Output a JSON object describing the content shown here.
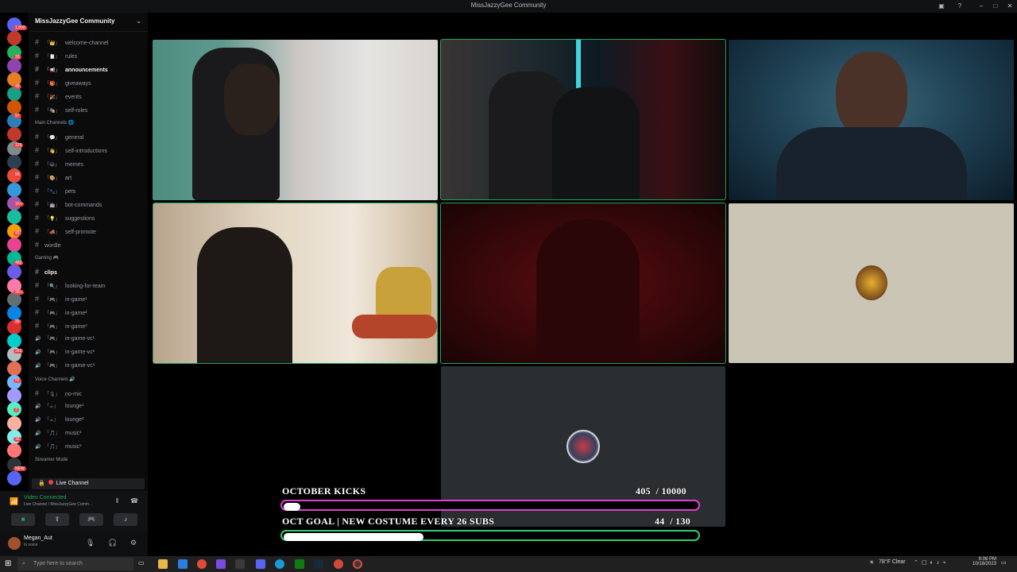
{
  "window": {
    "title": "MissJazzyGee Community"
  },
  "server": {
    "name": "MissJazzyGee Community"
  },
  "channels": [
    {
      "emoji": "「👑」",
      "name": "welcome-channel",
      "type": "text",
      "bright": false
    },
    {
      "emoji": "「📋」",
      "name": "rules",
      "type": "text",
      "bright": false
    },
    {
      "emoji": "「📢」",
      "name": "announcements",
      "type": "text",
      "bright": true
    },
    {
      "emoji": "「🎁」",
      "name": "giveaways",
      "type": "text",
      "bright": false
    },
    {
      "emoji": "「🎉」",
      "name": "events",
      "type": "text",
      "bright": false
    },
    {
      "emoji": "「🎭」",
      "name": "self-roles",
      "type": "text",
      "bright": false
    }
  ],
  "categories": {
    "main": "Main Channels 🌐",
    "gaming": "Gaming 🎮",
    "voice": "Voice Channels 🔊",
    "streamer": "Streamer Mode"
  },
  "main_channels": [
    {
      "emoji": "「💬」",
      "name": "general",
      "type": "text"
    },
    {
      "emoji": "「👋」",
      "name": "self-introductions",
      "type": "text"
    },
    {
      "emoji": "「😂」",
      "name": "memes",
      "type": "text"
    },
    {
      "emoji": "「🎨」",
      "name": "art",
      "type": "text"
    },
    {
      "emoji": "「🐾」",
      "name": "pets",
      "type": "text"
    },
    {
      "emoji": "「🤖」",
      "name": "bot-commands",
      "type": "text"
    },
    {
      "emoji": "「💡」",
      "name": "suggestions",
      "type": "text"
    },
    {
      "emoji": "「📣」",
      "name": "self-promote",
      "type": "text"
    },
    {
      "emoji": "",
      "name": "wordle",
      "type": "text"
    }
  ],
  "gaming_channels": [
    {
      "emoji": "",
      "name": "clips",
      "type": "text",
      "bright": true
    },
    {
      "emoji": "「🔍」",
      "name": "looking-for-team",
      "type": "text"
    },
    {
      "emoji": "「🎮」",
      "name": "in-game¹",
      "type": "text"
    },
    {
      "emoji": "「🎮」",
      "name": "in-game²",
      "type": "text"
    },
    {
      "emoji": "「🎮」",
      "name": "in-game³",
      "type": "text"
    },
    {
      "emoji": "「🎮」",
      "name": "in-game-vc¹",
      "type": "voice"
    },
    {
      "emoji": "「🎮」",
      "name": "in-game-vc²",
      "type": "voice"
    },
    {
      "emoji": "「🎮」",
      "name": "in-game-vc³",
      "type": "voice"
    }
  ],
  "voice_channels": [
    {
      "emoji": "「🎙」",
      "name": "no-mic",
      "type": "text"
    },
    {
      "emoji": "「☕」",
      "name": "lounge¹",
      "type": "voice"
    },
    {
      "emoji": "「☕」",
      "name": "lounge²",
      "type": "voice"
    },
    {
      "emoji": "「🎵」",
      "name": "music¹",
      "type": "voice"
    },
    {
      "emoji": "「🎵」",
      "name": "music²",
      "type": "voice"
    }
  ],
  "live_channel": "Live Channel",
  "voice_status": {
    "title": "Video Connected",
    "subtitle": "Live Channel / MissJazzyGee Comm..."
  },
  "user": {
    "name": "Megan_Aut",
    "status": "In voice"
  },
  "goals": [
    {
      "label": "OCTOBER KICKS",
      "current": "405",
      "target": "10000",
      "value": 405,
      "max": 10000,
      "color": "#e040d0"
    },
    {
      "label": "OCT GOAL | NEW COSTUME EVERY 26 SUBS",
      "current": "44",
      "target": "130",
      "value": 44,
      "max": 130,
      "color": "#2ecc71"
    }
  ],
  "taskbar": {
    "search_placeholder": "Type here to search",
    "weather": "78°F  Clear",
    "time": "9:06 PM",
    "date": "10/18/2023"
  },
  "rail_badges": [
    "1,000",
    "33",
    "49",
    "97",
    "125",
    "96",
    "1K+",
    "43",
    "483",
    "2K+",
    "29",
    "263",
    "55",
    "3",
    "16",
    "NEW"
  ]
}
